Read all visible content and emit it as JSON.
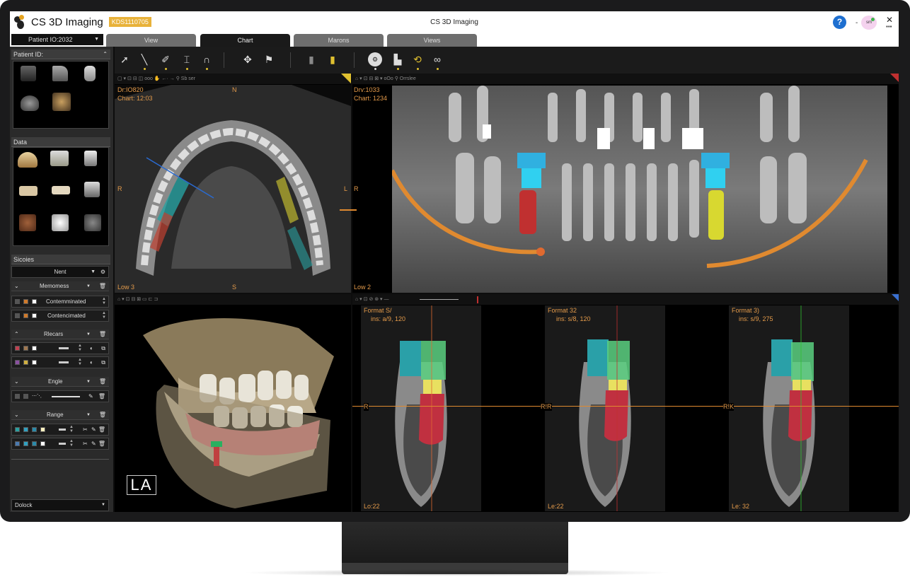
{
  "app": {
    "title": "CS 3D Imaging",
    "serial_badge": "KDS1110705",
    "window_title": "CS 3D Imaging",
    "help": "?",
    "user_dash": "-",
    "user_initials": "sm",
    "close": "✕",
    "more": "▪▪▪"
  },
  "patient_select": {
    "value": "Patient IO:2032"
  },
  "tabs": [
    {
      "label": "View",
      "active": false
    },
    {
      "label": "Chart",
      "active": true
    },
    {
      "label": "Marons",
      "active": false
    },
    {
      "label": "Views",
      "active": false
    }
  ],
  "left": {
    "patient_header": "Patient ID:",
    "data_header": "Data",
    "studies_header": "Sicoies",
    "studies_select": "Nent",
    "groups": [
      {
        "label": "Memomess",
        "rows": [
          {
            "label": "Contemminated",
            "colors": [
              "#555555",
              "#d07a2a",
              "#ffffff"
            ]
          },
          {
            "label": "Contencimated",
            "colors": [
              "#555555",
              "#d07a2a",
              "#ffffff"
            ]
          }
        ]
      },
      {
        "label": "Rlecars",
        "rows": [
          {
            "label": "",
            "colors": [
              "#c04050",
              "#a07850",
              "#ffffff"
            ]
          },
          {
            "label": "",
            "colors": [
              "#8a50a0",
              "#d0b040",
              "#ffffff"
            ]
          }
        ]
      },
      {
        "label": "Engle",
        "rows": [
          {
            "label": "",
            "colors": [
              "#555555",
              "#555555"
            ]
          }
        ]
      },
      {
        "label": "Range",
        "rows": [
          {
            "label": "",
            "colors": [
              "#2aa0a0",
              "#30a0c0",
              "#2a8aaa",
              "#fff0c0"
            ]
          },
          {
            "label": "",
            "colors": [
              "#4a7ab0",
              "#30a0c0",
              "#2a8aaa",
              "#ffffff"
            ]
          }
        ]
      }
    ],
    "bottom_select": "Dolock"
  },
  "viewports": {
    "axial": {
      "toolbar": "▢ ▾  ⊡  ⊟  ◫  ooo   ✋   ←· →   ⚲  Sb ser",
      "top_left": [
        "Dr:IO820",
        "Chart: 12:03"
      ],
      "top": "N",
      "left": "R",
      "right": "L",
      "bottom": "S",
      "bottom_left": "Low 3"
    },
    "pano": {
      "toolbar": "⌂ ▾ ⊡  ⊟  ⊠ ▾ oOo   ⚲  Orrslee",
      "top_left": [
        "Drv:1033",
        "Chart: 1234"
      ],
      "left": "R",
      "bottom_left": "Low 2"
    },
    "three_d": {
      "toolbar": "⌂ ▾ ⊡  ⊟  ⊠  ▭  ⊏  ⊐",
      "orientation": "LA"
    },
    "slices_toolbar": "⌂ ▾ ⊡  ⊘  ⊛ ▾  —",
    "slices": [
      {
        "title": "Format S/",
        "sub": "ins: a/9, 120",
        "mid": "R",
        "bottom": "Lo:22"
      },
      {
        "title": "Format 32",
        "sub": "ins: s/8, 120",
        "mid": "R!R",
        "bottom": "Le:22"
      },
      {
        "title": "Format 3)",
        "sub": "ins: s/9, 275",
        "mid": "R!K",
        "bottom": "Le: 32"
      }
    ]
  }
}
